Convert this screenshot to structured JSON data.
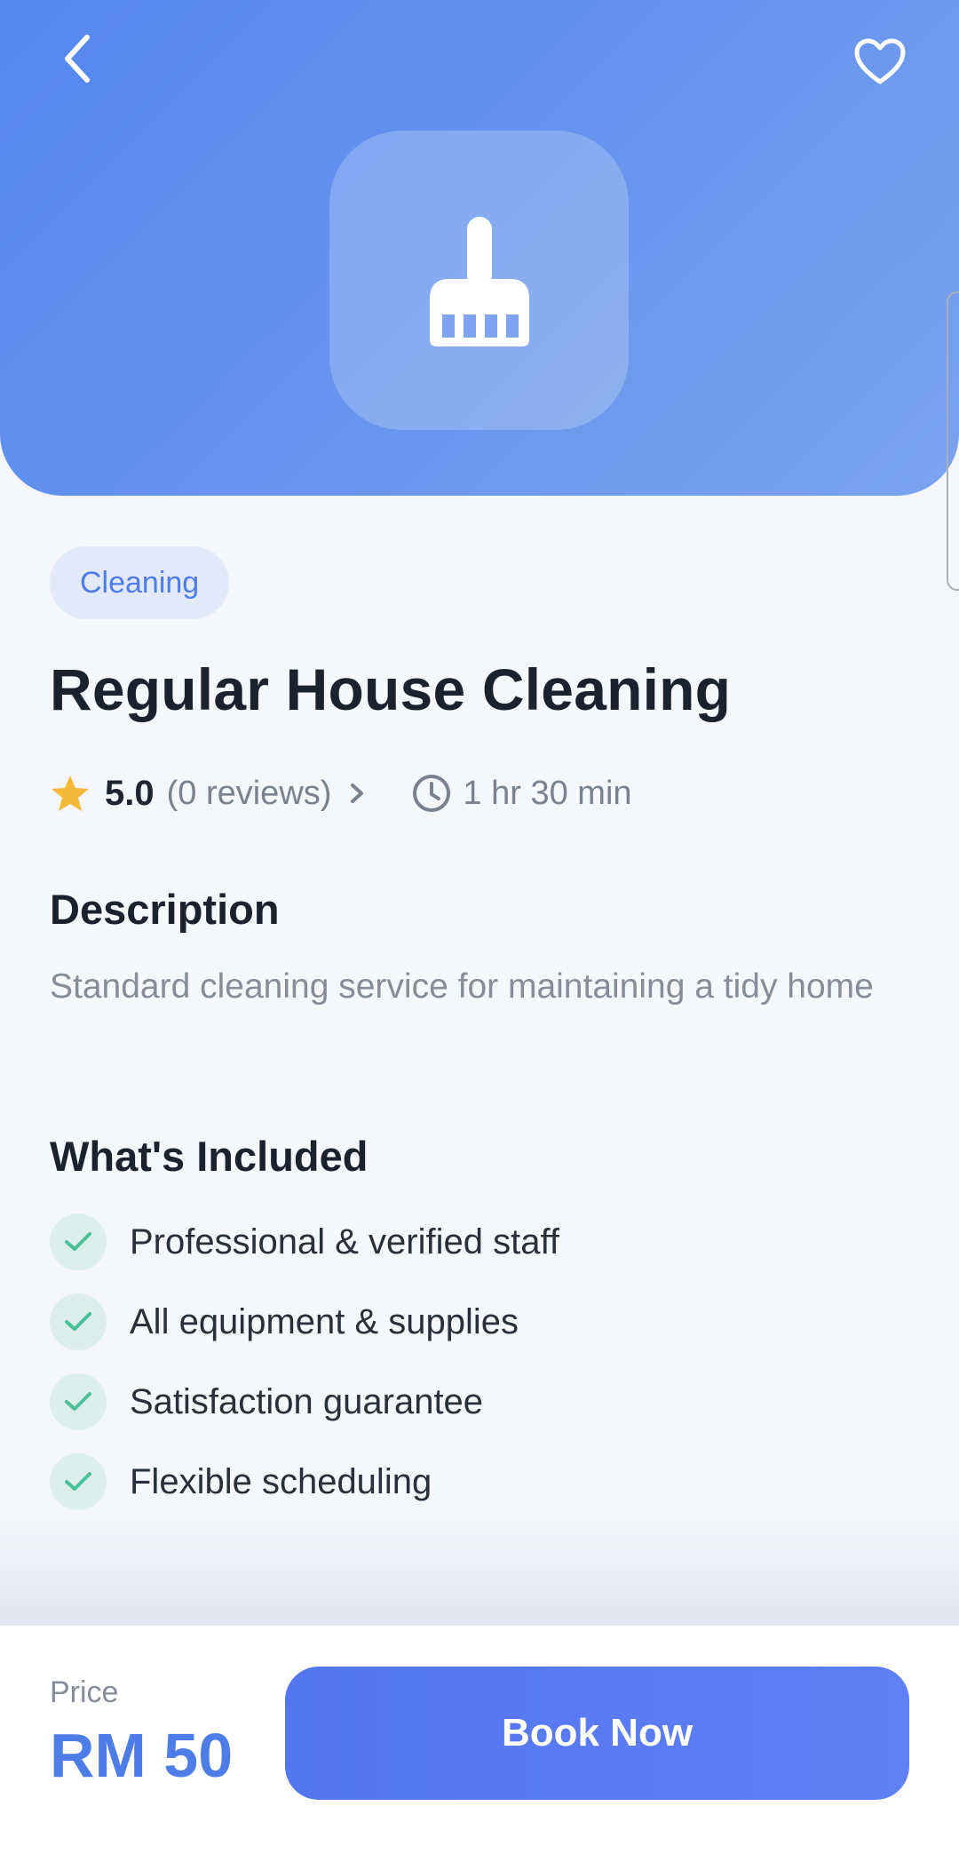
{
  "header": {
    "back_icon": "chevron-left-icon",
    "favorite_icon": "heart-outline-icon",
    "service_icon": "broom-icon",
    "gradient_start": "#5486ee",
    "gradient_end": "#7ba3ee"
  },
  "service": {
    "category": "Cleaning",
    "title": "Regular House Cleaning",
    "rating": "5.0",
    "reviews": "(0 reviews)",
    "duration": "1 hr 30 min"
  },
  "description": {
    "heading": "Description",
    "text": "Standard cleaning service for maintaining a tidy home"
  },
  "included": {
    "heading": "What's Included",
    "items": [
      "Professional & verified staff",
      "All equipment & supplies",
      "Satisfaction guarantee",
      "Flexible scheduling"
    ]
  },
  "footer": {
    "price_label": "Price",
    "price_value": "RM 50",
    "book_label": "Book Now"
  },
  "colors": {
    "accent": "#4f7de8",
    "button": "#5a7af2",
    "star": "#f5b93a",
    "check": "#4cc09a"
  }
}
